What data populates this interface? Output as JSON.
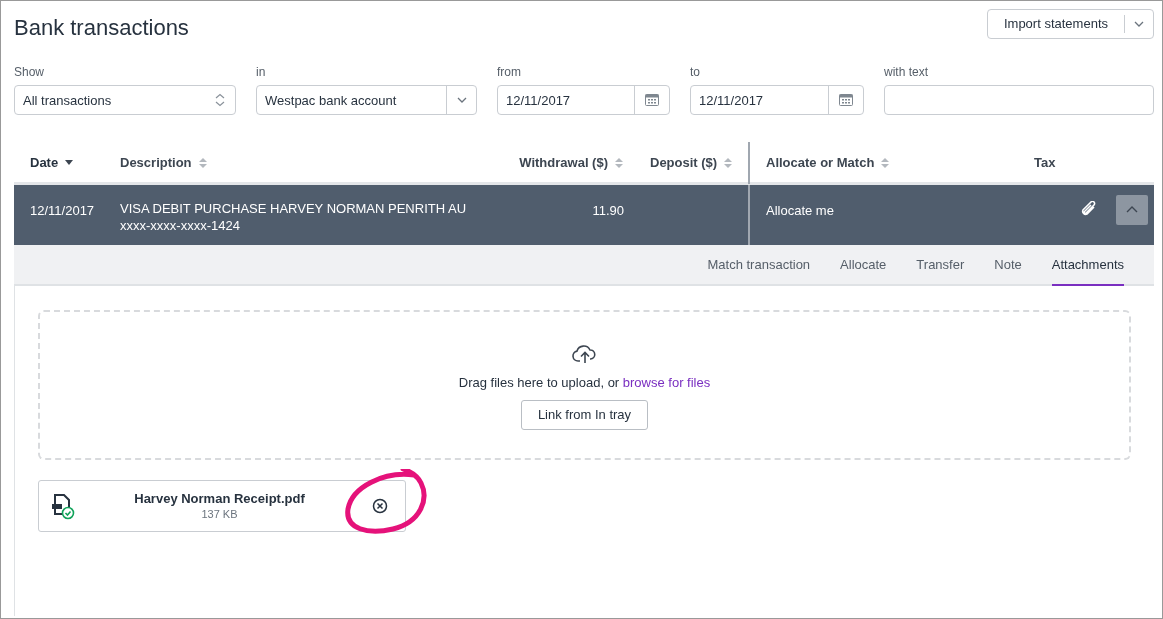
{
  "title": "Bank transactions",
  "import_button": {
    "label": "Import statements"
  },
  "filters": [
    {
      "kind": "select",
      "label": "Show",
      "value": "All transactions"
    },
    {
      "kind": "dropdown",
      "label": "in",
      "value": "Westpac bank account"
    },
    {
      "kind": "date",
      "label": "from",
      "value": "12/11/2017"
    },
    {
      "kind": "date",
      "label": "to",
      "value": "12/11/2017"
    },
    {
      "kind": "text",
      "label": "with text"
    }
  ],
  "columns": [
    {
      "label": "Date",
      "sortable": true,
      "sorted": true
    },
    {
      "label": "Description",
      "sortable": true,
      "sorted": false
    },
    {
      "label": "Withdrawal ($)",
      "sortable": true,
      "sorted": false
    },
    {
      "label": "Deposit ($)",
      "sortable": true,
      "sorted": false
    },
    {
      "label": "Allocate or Match",
      "sortable": true,
      "sorted": false
    },
    {
      "label": "Tax",
      "sortable": false,
      "sorted": false
    }
  ],
  "row": {
    "date": "12/11/2017",
    "description": "VISA DEBIT PURCHASE HARVEY NORMAN PENRITH AU",
    "account": "xxxx-xxxx-xxxx-1424",
    "withdrawal": "11.90",
    "allocate": "Allocate me",
    "expanded": true
  },
  "tabs": [
    {
      "label": "Match transaction",
      "selected": false
    },
    {
      "label": "Allocate",
      "selected": false
    },
    {
      "label": "Transfer",
      "selected": false
    },
    {
      "label": "Note",
      "selected": false
    },
    {
      "label": "Attachments",
      "selected": true
    }
  ],
  "upload": {
    "text": "Drag files here to upload, or",
    "link": "browse for files",
    "button": "Link from In tray"
  },
  "attachments": [
    {
      "name": "Harvey Norman Receipt.pdf",
      "size": "137 KB",
      "uploaded": true
    }
  ]
}
